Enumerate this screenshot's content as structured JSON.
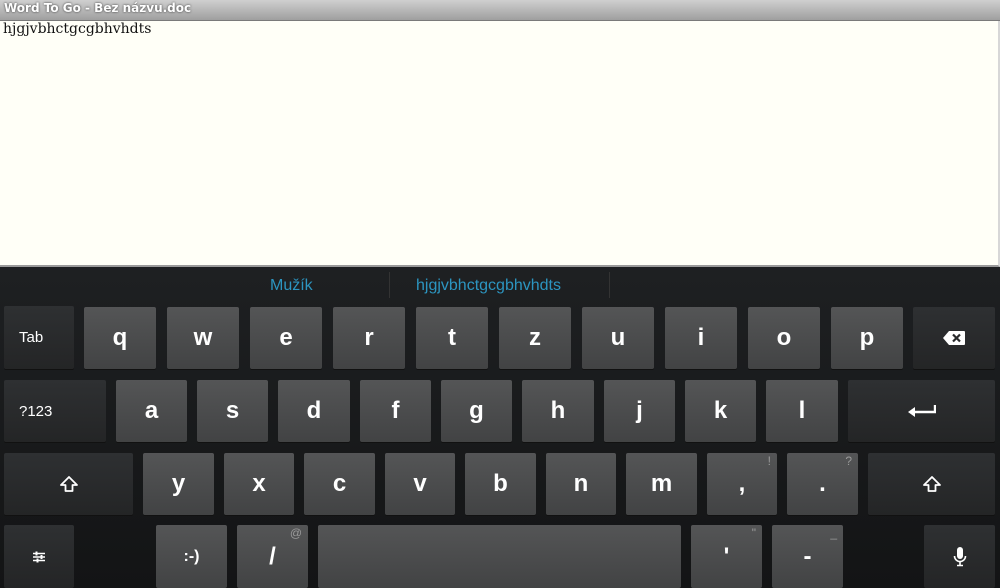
{
  "window": {
    "title": "Word To Go - Bez názvu.doc"
  },
  "document": {
    "text": "hjgjvbhctgcgbhvhdts"
  },
  "suggestions": [
    "Mužík",
    "hjgjvbhctgcgbhvhdts"
  ],
  "keyboard": {
    "row1": [
      "q",
      "w",
      "e",
      "r",
      "t",
      "z",
      "u",
      "i",
      "o",
      "p"
    ],
    "row2": [
      "a",
      "s",
      "d",
      "f",
      "g",
      "h",
      "j",
      "k",
      "l"
    ],
    "row3": [
      "y",
      "x",
      "c",
      "v",
      "b",
      "n",
      "m",
      ",",
      "."
    ],
    "row3_hints": [
      "!",
      "?"
    ],
    "tab_label": "Tab",
    "symbols_label": "?123",
    "smiley_label": ":-)",
    "slash_label": "/",
    "slash_hint": "@",
    "apostrophe_label": "'",
    "apostrophe_hint": "\"",
    "dash_label": "-",
    "dash_hint": "_",
    "icons": [
      "backspace-icon",
      "enter-icon",
      "shift-icon",
      "settings-icon",
      "mic-icon"
    ]
  },
  "colors": {
    "suggestion": "#2c95c0",
    "key": "#4a4b4c",
    "keyboard_bg": "#1b1c1d",
    "document_bg": "#fffff7"
  }
}
